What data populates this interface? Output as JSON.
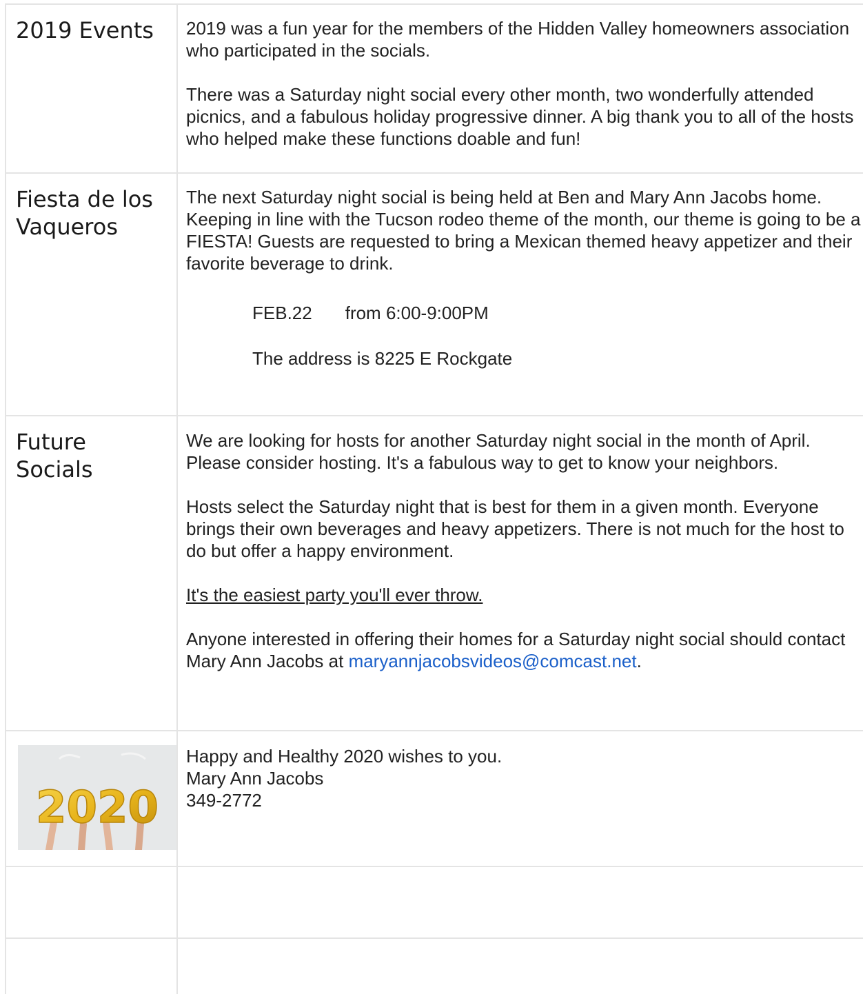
{
  "rows": [
    {
      "heading": "2019 Events",
      "paragraphs": [
        "2019 was a fun year for the members of the Hidden Valley homeowners association who participated in the socials.",
        "There was a Saturday night social every other month, two wonderfully attended picnics, and a fabulous holiday progressive dinner. A big thank you to all of the hosts who helped make these functions doable and fun!"
      ]
    },
    {
      "heading_line1": "Fiesta de los",
      "heading_line2": "Vaqueros",
      "paragraph": "The next Saturday night social is being held at Ben and Mary Ann Jacobs home. Keeping in line with the Tucson rodeo theme of the month, our theme is going to be a FIESTA! Guests are requested to bring a Mexican themed heavy appetizer and their favorite beverage to drink.",
      "date": "FEB.22",
      "time": "from 6:00-9:00PM",
      "address": "The address is 8225 E Rockgate"
    },
    {
      "heading_line1": "Future",
      "heading_line2": "Socials",
      "paragraph1": "We are looking for hosts for another Saturday night social in the month of April. Please consider hosting. It's a fabulous way to get to know your neighbors.",
      "paragraph2": "Hosts select the Saturday night that is best for them in a given month. Everyone brings their own beverages and heavy appetizers. There is not much for the host to do but offer a happy environment.",
      "underlined": "It's the easiest party you'll ever throw.",
      "contact_text": "Anyone interested in offering their homes for a Saturday night social should contact Mary Ann Jacobs at ",
      "email": "maryannjacobsvideos@comcast.net",
      "period": "."
    },
    {
      "image_text": "2020",
      "wishes": "Happy and Healthy 2020 wishes to you.",
      "name": "Mary Ann Jacobs",
      "phone": "349-2772"
    }
  ],
  "colors": {
    "link": "#1a5fc9",
    "border": "#e4e4e4",
    "balloon": "#e8b51c"
  }
}
